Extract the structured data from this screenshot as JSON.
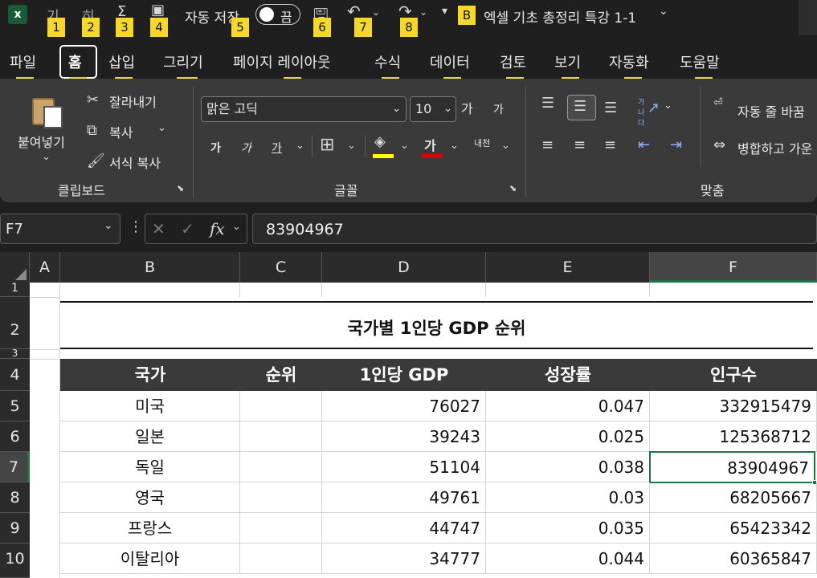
{
  "titlebar": {
    "autosave_label": "자동 저장",
    "autosave_state": "끔",
    "doc_title": "엑셀 기초 총정리 특강 1-1",
    "keytips": [
      "1",
      "2",
      "3",
      "4",
      "5",
      "6",
      "7",
      "8",
      "B"
    ],
    "partial_left": [
      "기",
      "히"
    ]
  },
  "tabs": [
    {
      "label": "파일",
      "keytip": "F"
    },
    {
      "label": "홈",
      "keytip": "H"
    },
    {
      "label": "삽입",
      "keytip": "N"
    },
    {
      "label": "그리기",
      "keytip": "JI"
    },
    {
      "label": "페이지 레이아웃",
      "keytip": "P"
    },
    {
      "label": "수식",
      "keytip": "M"
    },
    {
      "label": "데이터",
      "keytip": "A"
    },
    {
      "label": "검토",
      "keytip": "R"
    },
    {
      "label": "보기",
      "keytip": "W"
    },
    {
      "label": "자동화",
      "keytip": "U"
    },
    {
      "label": "도움말",
      "keytip": "Y"
    }
  ],
  "ribbon": {
    "clipboard": {
      "paste": "붙여넣기",
      "cut": "잘라내기",
      "copy": "복사",
      "format_painter": "서식 복사",
      "group_label": "클립보드"
    },
    "font": {
      "font_name": "맑은 고딕",
      "font_size": "10",
      "grow": "가",
      "shrink": "가",
      "bold": "가",
      "italic": "가",
      "underline": "가",
      "font_color_glyph": "가",
      "phonetic": "내천",
      "group_label": "글꼴"
    },
    "alignment": {
      "wrap_text": "자동 줄 바꿈",
      "merge": "병합하고 가운",
      "group_label": "맞춤",
      "orient_glyph": "가나다"
    }
  },
  "formula": {
    "name_box": "F7",
    "fx": "fx",
    "content": "83904967"
  },
  "sheet": {
    "columns": [
      "A",
      "B",
      "C",
      "D",
      "E",
      "F"
    ],
    "rows": [
      "1",
      "2",
      "3",
      "4",
      "5",
      "6",
      "7",
      "8",
      "9",
      "10"
    ],
    "title": "국가별 1인당 GDP 순위",
    "headers": [
      "국가",
      "순위",
      "1인당 GDP",
      "성장률",
      "인구수"
    ],
    "data": [
      [
        "미국",
        "",
        "76027",
        "0.047",
        "332915479"
      ],
      [
        "일본",
        "",
        "39243",
        "0.025",
        "125368712"
      ],
      [
        "독일",
        "",
        "51104",
        "0.038",
        "83904967"
      ],
      [
        "영국",
        "",
        "49761",
        "0.03",
        "68205667"
      ],
      [
        "프랑스",
        "",
        "44747",
        "0.035",
        "65423342"
      ],
      [
        "이탈리아",
        "",
        "34777",
        "0.044",
        "60365847"
      ]
    ]
  },
  "colors": {
    "keytip": "#f5d82b",
    "header_fill": "#3a3a3a",
    "selection": "#217346",
    "font_color_bar": "#e00000",
    "fill_color_bar": "#ffff00"
  }
}
